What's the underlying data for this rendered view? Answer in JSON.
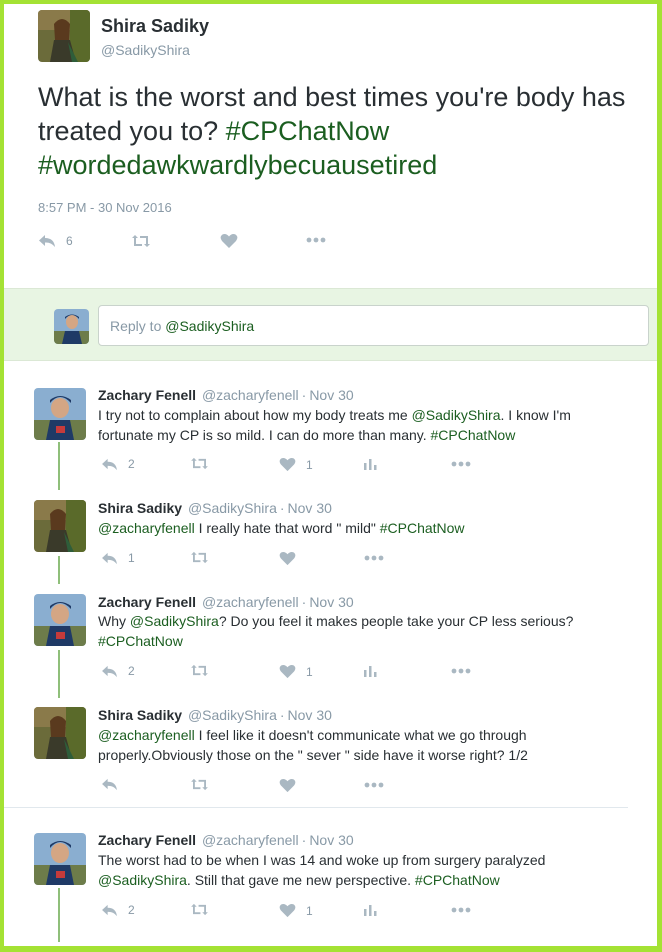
{
  "main_tweet": {
    "author_name": "Shira Sadiky",
    "author_handle": "@SadikyShira",
    "text_plain": "What is the worst and best times you're body has treated you to? ",
    "hashtag1": "#CPChatNow",
    "hashtag2": "#wordedawkwardlybecuausetired",
    "timestamp": "8:57 PM - 30 Nov 2016",
    "reply_count": "6",
    "icons": [
      "reply-icon",
      "retweet-icon",
      "like-icon",
      "more-icon"
    ]
  },
  "reply_box": {
    "prefix": "Reply to ",
    "mention": "@SadikyShira"
  },
  "thread": [
    {
      "name": "Zachary Fenell",
      "handle": "@zacharyfenell",
      "date": "Nov 30",
      "line1_a": "I try not to complain about how my body treats me ",
      "line1_mention": "@SadikyShira",
      "line1_b": ". I know I'm",
      "line2_a": "fortunate my CP is so mild. I can do more than many. ",
      "line2_tag": "#CPChatNow",
      "reply_count": "2",
      "like_count": "1"
    },
    {
      "name": "Shira Sadiky",
      "handle": "@SadikyShira",
      "date": "Nov 30",
      "mention": "@zacharyfenell",
      "text": " I really hate that word \" mild\" ",
      "tag": "#CPChatNow",
      "reply_count": "1"
    },
    {
      "name": "Zachary Fenell",
      "handle": "@zacharyfenell",
      "date": "Nov 30",
      "prefix": "Why ",
      "mention": "@SadikyShira",
      "text": "? Do you feel it makes people take your CP less serious?",
      "tag": "#CPChatNow",
      "reply_count": "2",
      "like_count": "1"
    },
    {
      "name": "Shira Sadiky",
      "handle": "@SadikyShira",
      "date": "Nov 30",
      "mention": "@zacharyfenell",
      "line1": " I feel like it doesn't communicate what we go through",
      "line2": "properly.Obviously those on the \" sever \" side have it worse right? 1/2"
    },
    {
      "name": "Zachary Fenell",
      "handle": "@zacharyfenell",
      "date": "Nov 30",
      "line1": "The worst had to be when I was 14 and woke up from surgery paralyzed",
      "mention": "@SadikyShira",
      "line2_b": ". Still that gave me new perspective. ",
      "tag": "#CPChatNow",
      "reply_count": "2",
      "like_count": "1"
    }
  ],
  "colors": {
    "frame": "#a4e234",
    "link": "#1b5e20",
    "reply_area_bg": "#e8f5e3",
    "muted": "#8899a6",
    "icon": "#aab8c2"
  }
}
